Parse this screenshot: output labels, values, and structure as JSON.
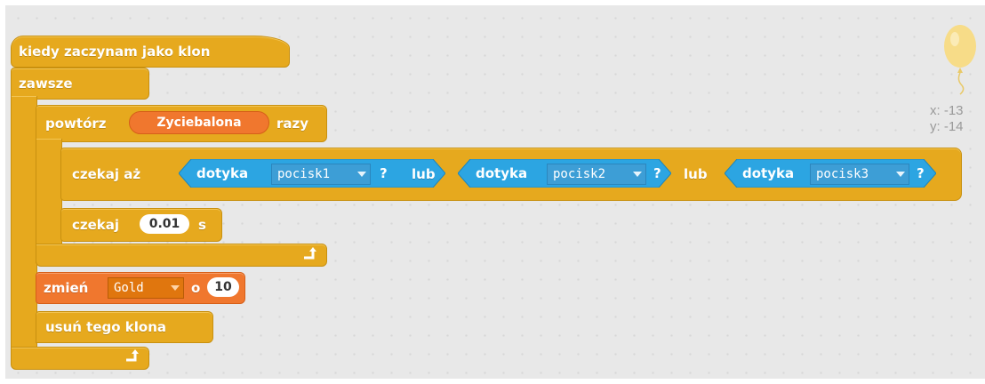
{
  "blocks": {
    "hat_label": "kiedy zaczynam jako klon",
    "forever_label": "zawsze",
    "repeat_label": "powtórz",
    "repeat_var": "Zyciebalona",
    "repeat_suffix": "razy",
    "wait_until_label": "czekaj aż",
    "touching_label": "dotyka",
    "or_label": "lub",
    "question_mark": "?",
    "touch_targets": [
      "pocisk1",
      "pocisk2",
      "pocisk3"
    ],
    "wait_label": "czekaj",
    "wait_value": "0.01",
    "wait_unit": "s",
    "change_label": "zmień",
    "change_var": "Gold",
    "change_by": "o",
    "change_value": "10",
    "delete_clone_label": "usuń tego klona"
  },
  "sprite_info": {
    "x_label": "x: -13",
    "y_label": "y: -14"
  },
  "colors": {
    "control": "#e6a91e",
    "sensing": "#2ca5e2",
    "variable": "#f0772e",
    "canvas": "#e8e8e8"
  },
  "icons": {
    "loop": "loop-arrow-icon",
    "balloon": "balloon-icon",
    "dropdown": "dropdown-arrow-icon"
  }
}
